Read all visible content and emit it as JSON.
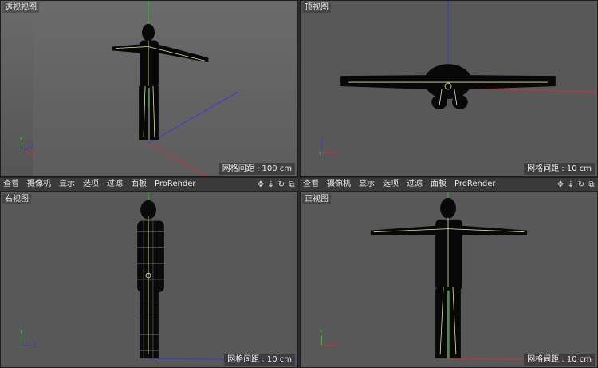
{
  "menu": {
    "items": [
      "查看",
      "摄像机",
      "显示",
      "选项",
      "过滤",
      "面板",
      "ProRender"
    ],
    "icons": [
      "move-icon",
      "arrow-down-icon",
      "rotate-icon",
      "maximize-icon"
    ]
  },
  "viewports": {
    "perspective": {
      "label": "透视视图",
      "grid": "网格间距 : 100 cm"
    },
    "top": {
      "label": "顶视图",
      "grid": "网格间距 : 10 cm"
    },
    "right": {
      "label": "右视图",
      "grid": "网格间距 : 10 cm"
    },
    "front": {
      "label": "正视图",
      "grid": "网格间距 : 10 cm"
    }
  },
  "colors": {
    "viewport_bg": "#5a5a5a",
    "axis_x": "#d23030",
    "axis_y": "#2ec52e",
    "axis_z": "#3a3ad8",
    "skeleton": "#e8e8a0"
  }
}
